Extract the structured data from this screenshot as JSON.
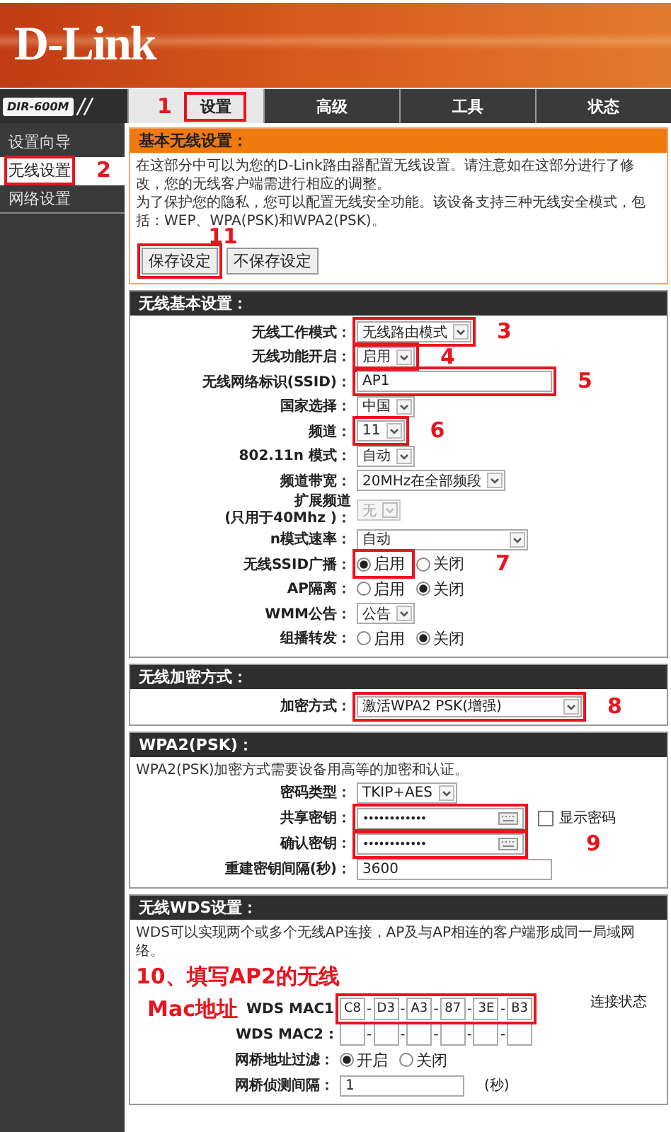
{
  "brand": {
    "logo": "D-Link",
    "model": "DIR-600M",
    "separator": "//"
  },
  "tabs": [
    {
      "label": "设置",
      "selected": true,
      "highlight": true,
      "annotation": "1"
    },
    {
      "label": "高级",
      "selected": false
    },
    {
      "label": "工具",
      "selected": false
    },
    {
      "label": "状态",
      "selected": false
    }
  ],
  "sidebar": {
    "items": [
      {
        "label": "设置向导",
        "selected": false
      },
      {
        "label": "无线设置",
        "selected": true,
        "highlight": true,
        "annotation": "2"
      },
      {
        "label": "网络设置",
        "selected": false
      }
    ]
  },
  "sections": [
    {
      "title": "基本无线设置：",
      "kind": "intro",
      "description": [
        "在这部分中可以为您的D-Link路由器配置无线设置。请注意如在这部分进行了修改，您的无线客户端需进行相应的调整。",
        "为了保护您的隐私，您可以配置无线安全功能。该设备支持三种无线安全模式，包括：WEP、WPA(PSK)和WPA2(PSK)。"
      ],
      "buttons": [
        {
          "label": "保存设定",
          "highlight": true,
          "annotation": "11"
        },
        {
          "label": "不保存设定"
        }
      ]
    },
    {
      "title": "无线基本设置：",
      "kind": "form",
      "rows": [
        {
          "kind": "select",
          "label": "无线工作模式：",
          "value": "无线路由模式",
          "highlight": true,
          "annotation": "3"
        },
        {
          "kind": "select",
          "label": "无线功能开启：",
          "value": "启用",
          "highlight": true,
          "annotation": "4"
        },
        {
          "kind": "text",
          "label": "无线网络标识(SSID)：",
          "value": "AP1",
          "highlight": true,
          "annotation": "5"
        },
        {
          "kind": "select",
          "label": "国家选择：",
          "value": "中国"
        },
        {
          "kind": "select",
          "label": "频道：",
          "value": "11",
          "highlight": true,
          "annotation": "6"
        },
        {
          "kind": "select",
          "label": "802.11n 模式：",
          "value": "自动"
        },
        {
          "kind": "select",
          "label": "频道带宽：",
          "value": "20MHz在全部频段"
        },
        {
          "kind": "select",
          "label": "扩展频道",
          "note": "(只用于40Mhz )：",
          "value": "无",
          "disabled": true
        },
        {
          "kind": "select",
          "label": "n模式速率：",
          "value": "自动",
          "wide": true
        },
        {
          "kind": "radio",
          "label": "无线SSID广播：",
          "annotation": "7",
          "options": [
            {
              "label": "启用",
              "selected": true,
              "highlight": true
            },
            {
              "label": "关闭",
              "selected": false
            }
          ]
        },
        {
          "kind": "radio",
          "label": "AP隔离：",
          "options": [
            {
              "label": "启用",
              "selected": false
            },
            {
              "label": "关闭",
              "selected": true
            }
          ]
        },
        {
          "kind": "select",
          "label": "WMM公告：",
          "value": "公告"
        },
        {
          "kind": "radio",
          "label": "组播转发：",
          "options": [
            {
              "label": "启用",
              "selected": false
            },
            {
              "label": "关闭",
              "selected": true
            }
          ]
        }
      ]
    },
    {
      "title": "无线加密方式：",
      "kind": "form",
      "rows": [
        {
          "kind": "select",
          "label": "加密方式：",
          "value": "激活WPA2 PSK(增强)",
          "wide": true,
          "highlight": true,
          "annotation": "8"
        }
      ]
    },
    {
      "title": "WPA2(PSK)：",
      "kind": "form",
      "description": [
        "WPA2(PSK)加密方式需要设备用高等的加密和认证。"
      ],
      "rows": [
        {
          "kind": "select",
          "label": "密码类型：",
          "value": "TKIP+AES"
        },
        {
          "kind": "password",
          "label": "共享密钥：",
          "value": "••••••••••••",
          "highlight": true,
          "checkbox": {
            "label": "显示密码",
            "checked": false
          }
        },
        {
          "kind": "password",
          "label": "确认密钥：",
          "value": "••••••••••••",
          "highlight": true,
          "annotation": "9"
        },
        {
          "kind": "text",
          "label": "重建密钥间隔(秒)：",
          "value": "3600"
        }
      ]
    },
    {
      "title": "无线WDS设置：",
      "kind": "wds",
      "description": [
        "WDS可以实现两个或多个无线AP连接，AP及与AP相连的客户端形成同一局域网络。"
      ],
      "note": "10、填写AP2的无线",
      "status_heading": "连接状态",
      "rows": [
        {
          "kind": "mac",
          "label": "WDS MAC1",
          "prefix": "Mac地址",
          "separator": "-",
          "highlight": true,
          "cells": [
            {
              "value": "C8"
            },
            {
              "value": "D3"
            },
            {
              "value": "A3"
            },
            {
              "value": "87"
            },
            {
              "value": "3E"
            },
            {
              "value": "B3"
            }
          ]
        },
        {
          "kind": "mac",
          "label": "WDS MAC2 :",
          "separator": "-",
          "cells": [
            {},
            {},
            {},
            {},
            {},
            {}
          ]
        },
        {
          "kind": "radio",
          "label": "网桥地址过滤：",
          "options": [
            {
              "label": "开启",
              "selected": true
            },
            {
              "label": "关闭",
              "selected": false
            }
          ]
        },
        {
          "kind": "text",
          "label": "网桥侦测间隔：",
          "value": "1",
          "unit": "(秒)"
        }
      ]
    }
  ]
}
